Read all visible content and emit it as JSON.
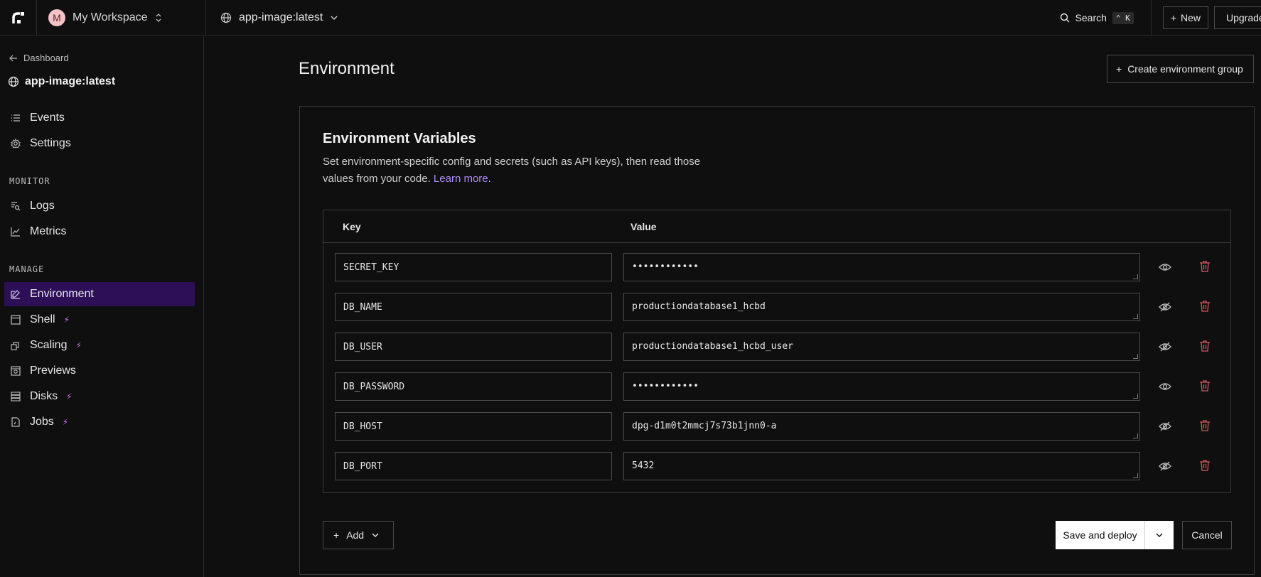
{
  "topbar": {
    "workspace_initial": "M",
    "workspace_name": "My Workspace",
    "service_name": "app-image:latest",
    "search_label": "Search",
    "search_shortcut": "⌃ K",
    "new_label": "New",
    "upgrade_label": "Upgrade"
  },
  "sidebar": {
    "back_label": "Dashboard",
    "service_name": "app-image:latest",
    "items_top": [
      {
        "label": "Events",
        "icon": "list-icon"
      },
      {
        "label": "Settings",
        "icon": "gear-icon"
      }
    ],
    "monitor_heading": "MONITOR",
    "monitor_items": [
      {
        "label": "Logs",
        "icon": "logs-icon"
      },
      {
        "label": "Metrics",
        "icon": "metrics-icon"
      }
    ],
    "manage_heading": "MANAGE",
    "manage_items": [
      {
        "label": "Environment",
        "icon": "environment-icon",
        "active": true,
        "bolt": false
      },
      {
        "label": "Shell",
        "icon": "shell-icon",
        "active": false,
        "bolt": true
      },
      {
        "label": "Scaling",
        "icon": "scaling-icon",
        "active": false,
        "bolt": true
      },
      {
        "label": "Previews",
        "icon": "previews-icon",
        "active": false,
        "bolt": false
      },
      {
        "label": "Disks",
        "icon": "disks-icon",
        "active": false,
        "bolt": true
      },
      {
        "label": "Jobs",
        "icon": "jobs-icon",
        "active": false,
        "bolt": true
      }
    ]
  },
  "main": {
    "title": "Environment",
    "create_group_label": "Create environment group",
    "card": {
      "title": "Environment Variables",
      "description": "Set environment-specific config and secrets (such as API keys), then read those values from your code.",
      "learn_more": "Learn more",
      "learn_more_suffix": ".",
      "col_key": "Key",
      "col_value": "Value",
      "rows": [
        {
          "key": "SECRET_KEY",
          "value": "••••••••••••",
          "hidden": true
        },
        {
          "key": "DB_NAME",
          "value": "productiondatabase1_hcbd",
          "hidden": false
        },
        {
          "key": "DB_USER",
          "value": "productiondatabase1_hcbd_user",
          "hidden": false
        },
        {
          "key": "DB_PASSWORD",
          "value": "••••••••••••",
          "hidden": true
        },
        {
          "key": "DB_HOST",
          "value": "dpg-d1m0t2mmcj7s73b1jnn0-a",
          "hidden": false
        },
        {
          "key": "DB_PORT",
          "value": "5432",
          "hidden": false
        }
      ],
      "add_label": "Add",
      "save_label": "Save and deploy",
      "cancel_label": "Cancel"
    }
  },
  "colors": {
    "background": "#0f0f0f",
    "active_nav": "#2d0f57",
    "accent_link": "#b08cff",
    "bolt": "#d46bf0",
    "trash": "#d05a5a"
  }
}
